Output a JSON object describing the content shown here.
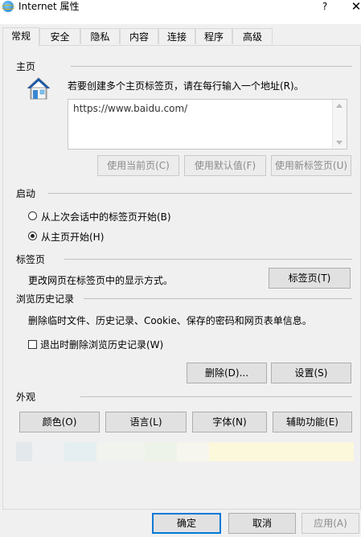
{
  "window": {
    "title": "Internet 属性",
    "help_label": "?",
    "close_label": "✕"
  },
  "tabs": [
    {
      "label": "常规",
      "active": true
    },
    {
      "label": "安全"
    },
    {
      "label": "隐私"
    },
    {
      "label": "内容"
    },
    {
      "label": "连接"
    },
    {
      "label": "程序"
    },
    {
      "label": "高级"
    }
  ],
  "homepage": {
    "section_title": "主页",
    "instruction": "若要创建多个主页标签页，请在每行输入一个地址(R)。",
    "url_value": "https://www.baidu.com/",
    "use_current_label": "使用当前页(C)",
    "use_default_label": "使用默认值(F)",
    "use_new_tab_label": "使用新标签页(U)"
  },
  "startup": {
    "section_title": "启动",
    "option_last_session": "从上次会话中的标签页开始(B)",
    "option_homepage": "从主页开始(H)",
    "selected": "homepage"
  },
  "tabs_section": {
    "section_title": "标签页",
    "description": "更改网页在标签页中的显示方式。",
    "tabs_button_label": "标签页(T)"
  },
  "history": {
    "section_title": "浏览历史记录",
    "description": "删除临时文件、历史记录、Cookie、保存的密码和网页表单信息。",
    "delete_on_exit_label": "退出时删除浏览历史记录(W)",
    "delete_on_exit_checked": false,
    "delete_button_label": "删除(D)...",
    "settings_button_label": "设置(S)"
  },
  "appearance": {
    "section_title": "外观",
    "colors_label": "颜色(O)",
    "languages_label": "语言(L)",
    "fonts_label": "字体(N)",
    "accessibility_label": "辅助功能(E)"
  },
  "footer": {
    "ok_label": "确定",
    "cancel_label": "取消",
    "apply_label": "应用(A)"
  }
}
